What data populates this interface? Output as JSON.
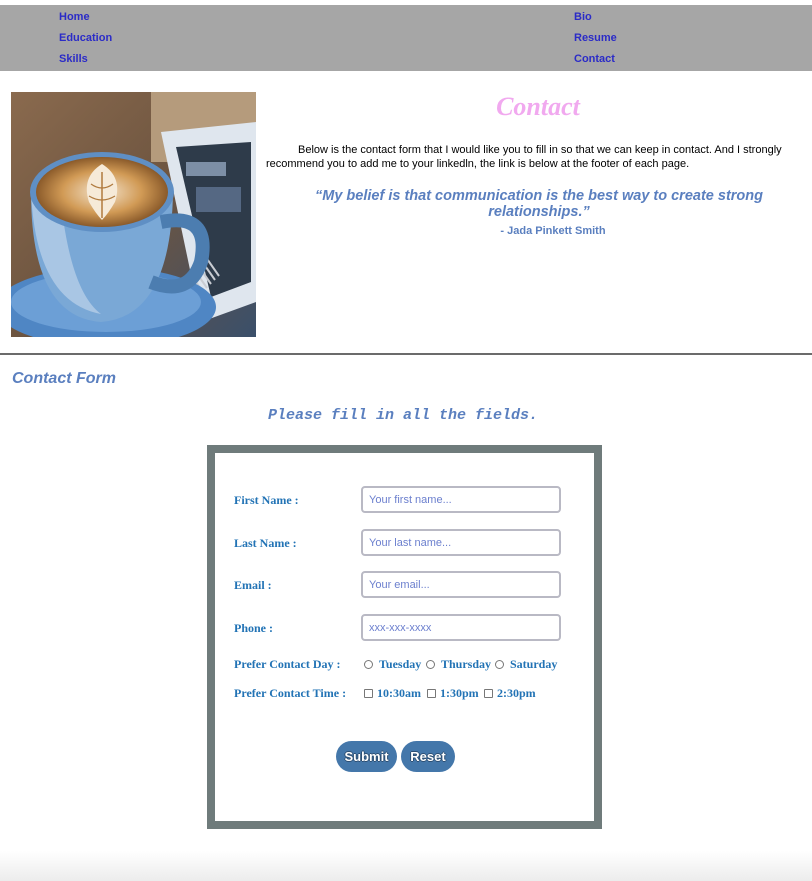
{
  "nav": {
    "left": [
      "Home",
      "Education",
      "Skills"
    ],
    "right": [
      "Bio",
      "Resume",
      "Contact"
    ]
  },
  "header": {
    "title": "Contact",
    "intro": "Below is the contact form that I would like you to fill in so that we can keep in contact. And I strongly recommend you to add me to your linkedln, the link is below at the footer of each page.",
    "quote": "“My belief is that communication is the best way to create strong relationships.”",
    "author": "- Jada Pinkett Smith"
  },
  "form_section": {
    "heading": "Contact Form",
    "note": "Please fill in all the fields."
  },
  "form": {
    "first_name": {
      "label": "First Name :",
      "placeholder": "Your first name..."
    },
    "last_name": {
      "label": "Last Name :",
      "placeholder": "Your last name..."
    },
    "email": {
      "label": "Email :",
      "placeholder": "Your email..."
    },
    "phone": {
      "label": "Phone :",
      "placeholder": "xxx-xxx-xxxx"
    },
    "contact_day": {
      "label": "Prefer Contact Day :",
      "options": [
        "Tuesday",
        "Thursday",
        "Saturday"
      ]
    },
    "contact_time": {
      "label": "Prefer Contact Time :",
      "options": [
        "10:30am",
        "1:30pm",
        "2:30pm"
      ]
    },
    "submit_label": "Submit",
    "reset_label": "Reset"
  },
  "colors": {
    "nav_bg": "#a6a6a6",
    "nav_link": "#2b2bc7",
    "title_pink": "#f1a9ef",
    "accent_blue": "#5a7fbf",
    "label_blue": "#2273b5",
    "button_bg": "#4477aa",
    "form_border": "#6f7b7b"
  },
  "image": {
    "description": "coffee-cup-photo"
  }
}
